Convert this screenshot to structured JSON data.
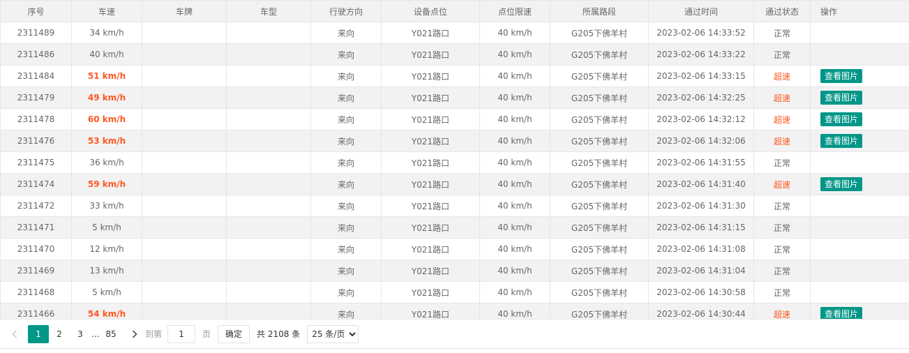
{
  "columns": [
    "序号",
    "车速",
    "车牌",
    "车型",
    "行驶方向",
    "设备点位",
    "点位限速",
    "所属路段",
    "通过时间",
    "通过状态",
    "操作"
  ],
  "rows": [
    {
      "id": "2311489",
      "speed": "34 km/h",
      "over": false,
      "plate": "",
      "vtype": "",
      "direction": "来向",
      "device": "Y021路口",
      "limit": "40 km/h",
      "road": "G205下佛羊村",
      "time": "2023-02-06 14:33:52",
      "status": "正常",
      "action": ""
    },
    {
      "id": "2311486",
      "speed": "40 km/h",
      "over": false,
      "plate": "",
      "vtype": "",
      "direction": "来向",
      "device": "Y021路口",
      "limit": "40 km/h",
      "road": "G205下佛羊村",
      "time": "2023-02-06 14:33:22",
      "status": "正常",
      "action": ""
    },
    {
      "id": "2311484",
      "speed": "51 km/h",
      "over": true,
      "plate": "",
      "vtype": "",
      "direction": "来向",
      "device": "Y021路口",
      "limit": "40 km/h",
      "road": "G205下佛羊村",
      "time": "2023-02-06 14:33:15",
      "status": "超速",
      "action": "查看图片"
    },
    {
      "id": "2311479",
      "speed": "49 km/h",
      "over": true,
      "plate": "",
      "vtype": "",
      "direction": "来向",
      "device": "Y021路口",
      "limit": "40 km/h",
      "road": "G205下佛羊村",
      "time": "2023-02-06 14:32:25",
      "status": "超速",
      "action": "查看图片"
    },
    {
      "id": "2311478",
      "speed": "60 km/h",
      "over": true,
      "plate": "",
      "vtype": "",
      "direction": "来向",
      "device": "Y021路口",
      "limit": "40 km/h",
      "road": "G205下佛羊村",
      "time": "2023-02-06 14:32:12",
      "status": "超速",
      "action": "查看图片"
    },
    {
      "id": "2311476",
      "speed": "53 km/h",
      "over": true,
      "plate": "",
      "vtype": "",
      "direction": "来向",
      "device": "Y021路口",
      "limit": "40 km/h",
      "road": "G205下佛羊村",
      "time": "2023-02-06 14:32:06",
      "status": "超速",
      "action": "查看图片"
    },
    {
      "id": "2311475",
      "speed": "36 km/h",
      "over": false,
      "plate": "",
      "vtype": "",
      "direction": "来向",
      "device": "Y021路口",
      "limit": "40 km/h",
      "road": "G205下佛羊村",
      "time": "2023-02-06 14:31:55",
      "status": "正常",
      "action": ""
    },
    {
      "id": "2311474",
      "speed": "59 km/h",
      "over": true,
      "plate": "",
      "vtype": "",
      "direction": "来向",
      "device": "Y021路口",
      "limit": "40 km/h",
      "road": "G205下佛羊村",
      "time": "2023-02-06 14:31:40",
      "status": "超速",
      "action": "查看图片"
    },
    {
      "id": "2311472",
      "speed": "33 km/h",
      "over": false,
      "plate": "",
      "vtype": "",
      "direction": "来向",
      "device": "Y021路口",
      "limit": "40 km/h",
      "road": "G205下佛羊村",
      "time": "2023-02-06 14:31:30",
      "status": "正常",
      "action": ""
    },
    {
      "id": "2311471",
      "speed": "5 km/h",
      "over": false,
      "plate": "",
      "vtype": "",
      "direction": "来向",
      "device": "Y021路口",
      "limit": "40 km/h",
      "road": "G205下佛羊村",
      "time": "2023-02-06 14:31:15",
      "status": "正常",
      "action": ""
    },
    {
      "id": "2311470",
      "speed": "12 km/h",
      "over": false,
      "plate": "",
      "vtype": "",
      "direction": "来向",
      "device": "Y021路口",
      "limit": "40 km/h",
      "road": "G205下佛羊村",
      "time": "2023-02-06 14:31:08",
      "status": "正常",
      "action": ""
    },
    {
      "id": "2311469",
      "speed": "13 km/h",
      "over": false,
      "plate": "",
      "vtype": "",
      "direction": "来向",
      "device": "Y021路口",
      "limit": "40 km/h",
      "road": "G205下佛羊村",
      "time": "2023-02-06 14:31:04",
      "status": "正常",
      "action": ""
    },
    {
      "id": "2311468",
      "speed": "5 km/h",
      "over": false,
      "plate": "",
      "vtype": "",
      "direction": "来向",
      "device": "Y021路口",
      "limit": "40 km/h",
      "road": "G205下佛羊村",
      "time": "2023-02-06 14:30:58",
      "status": "正常",
      "action": ""
    },
    {
      "id": "2311466",
      "speed": "54 km/h",
      "over": true,
      "plate": "",
      "vtype": "",
      "direction": "来向",
      "device": "Y021路口",
      "limit": "40 km/h",
      "road": "G205下佛羊村",
      "time": "2023-02-06 14:30:44",
      "status": "超速",
      "action": "查看图片"
    }
  ],
  "pager": {
    "prev_icon": "chevron-left-icon",
    "next_icon": "chevron-right-icon",
    "pages": [
      "1",
      "2",
      "3"
    ],
    "current": "1",
    "ellipsis": "…",
    "last_page": "85",
    "jump_label": "到第",
    "jump_value": "1",
    "page_suffix": "页",
    "confirm_label": "确定",
    "total_label": "共 2108 条",
    "page_size": "25 条/页"
  },
  "colors": {
    "accent": "#009688",
    "overspeed": "#ff5722",
    "header_bg": "#f2f2f2"
  }
}
